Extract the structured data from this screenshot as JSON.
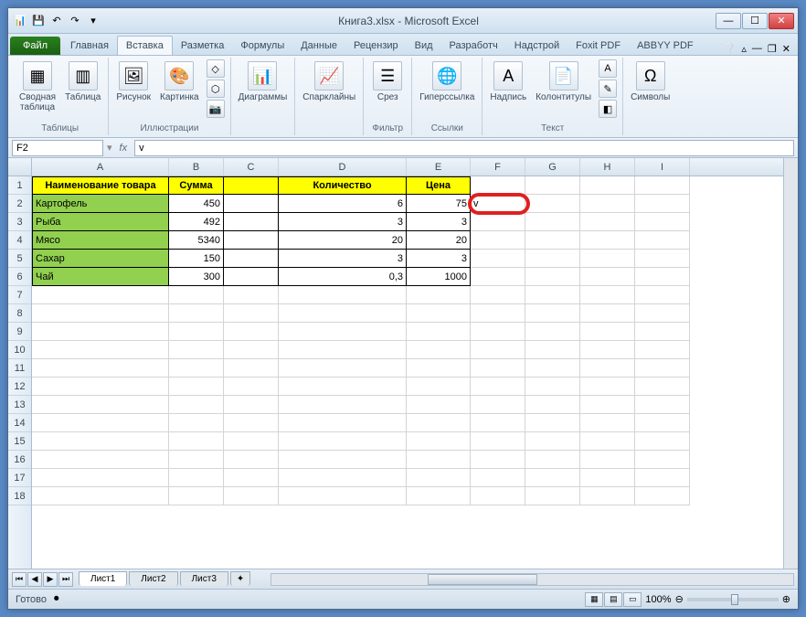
{
  "title": "Книга3.xlsx - Microsoft Excel",
  "tabs": {
    "file": "Файл",
    "t0": "Главная",
    "t1": "Вставка",
    "t2": "Разметка",
    "t3": "Формулы",
    "t4": "Данные",
    "t5": "Рецензир",
    "t6": "Вид",
    "t7": "Разработч",
    "t8": "Надстрой",
    "t9": "Foxit PDF",
    "t10": "ABBYY PDF"
  },
  "ribbon": {
    "g0": {
      "label": "Таблицы",
      "b0": "Сводная\nтаблица",
      "b1": "Таблица"
    },
    "g1": {
      "label": "Иллюстрации",
      "b0": "Рисунок",
      "b1": "Картинка"
    },
    "g2": {
      "label": "",
      "b0": "Диаграммы"
    },
    "g3": {
      "label": "",
      "b0": "Спарклайны"
    },
    "g4": {
      "label": "Фильтр",
      "b0": "Срез"
    },
    "g5": {
      "label": "Ссылки",
      "b0": "Гиперссылка"
    },
    "g6": {
      "label": "Текст",
      "b0": "Надпись",
      "b1": "Колонтитулы"
    },
    "g7": {
      "label": "",
      "b0": "Символы"
    }
  },
  "name_box": "F2",
  "formula": "v",
  "cols": [
    "A",
    "B",
    "C",
    "D",
    "E",
    "F",
    "G",
    "H",
    "I"
  ],
  "rows": [
    "1",
    "2",
    "3",
    "4",
    "5",
    "6",
    "7",
    "8",
    "9",
    "10",
    "11",
    "12",
    "13",
    "14",
    "15",
    "16",
    "17",
    "18"
  ],
  "headers": {
    "a": "Наименование товара",
    "b": "Сумма",
    "d": "Количество",
    "e": "Цена"
  },
  "data": [
    {
      "name": "Картофель",
      "sum": "450",
      "qty": "6",
      "price": "75"
    },
    {
      "name": "Рыба",
      "sum": "492",
      "qty": "3",
      "price": "3"
    },
    {
      "name": "Мясо",
      "sum": "5340",
      "qty": "20",
      "price": "20"
    },
    {
      "name": "Сахар",
      "sum": "150",
      "qty": "3",
      "price": "3"
    },
    {
      "name": "Чай",
      "sum": "300",
      "qty": "0,3",
      "price": "1000"
    }
  ],
  "f2_value": "v",
  "sheets": {
    "s1": "Лист1",
    "s2": "Лист2",
    "s3": "Лист3"
  },
  "status": "Готово",
  "zoom": "100%"
}
